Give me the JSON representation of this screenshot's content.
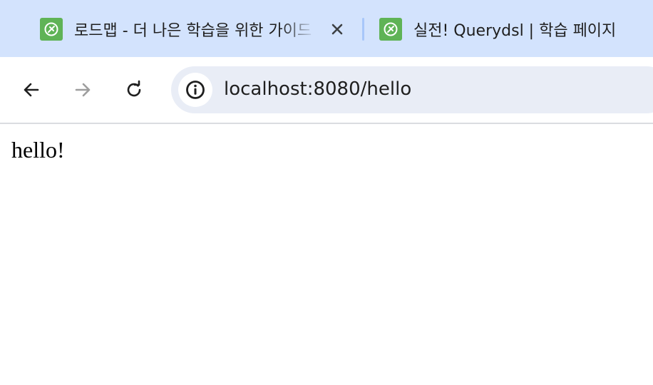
{
  "browser": {
    "tabs": [
      {
        "title": "로드맵 - 더 나은 학습을 위한 가이드",
        "favicon": "leaf-icon",
        "active": false
      },
      {
        "title": "실전! Querydsl | 학습 페이지",
        "favicon": "leaf-icon",
        "active": true
      }
    ],
    "address_bar": {
      "url": "localhost:8080/hello",
      "icon": "info-icon"
    },
    "nav": {
      "back": "arrow-left-icon",
      "forward": "arrow-right-icon",
      "reload": "reload-icon"
    }
  },
  "page": {
    "content": "hello!"
  },
  "colors": {
    "tabstrip_bg": "#d3e3fd",
    "omnibox_bg": "#e9edf6",
    "favicon_green": "#5fb356",
    "tab_separator": "#a8c7fa"
  }
}
